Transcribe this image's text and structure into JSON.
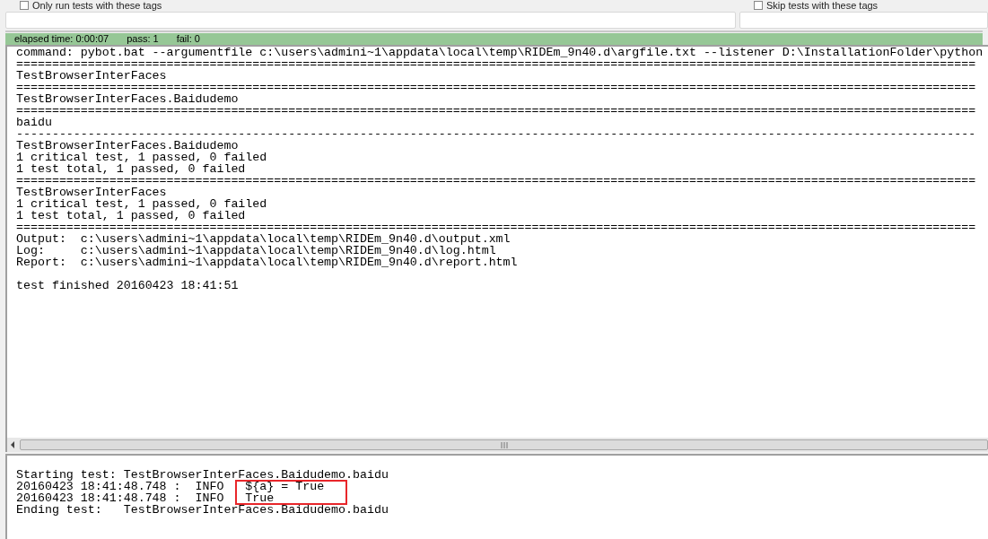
{
  "filters": [
    {
      "label": "Only run tests with these tags",
      "checked": false
    },
    {
      "label": "Skip tests with these tags",
      "checked": false
    }
  ],
  "status": {
    "elapsed": "elapsed time: 0:00:07",
    "pass": "pass: 1",
    "fail": "fail: 0"
  },
  "output_lines": [
    "command: pybot.bat --argumentfile c:\\users\\admini~1\\appdata\\local\\temp\\RIDEm_9n40.d\\argfile.txt --listener D:\\InstallationFolder\\python",
    "======================================================================================================================================",
    "TestBrowserInterFaces",
    "======================================================================================================================================",
    "TestBrowserInterFaces.Baidudemo",
    "======================================================================================================================================",
    "baidu",
    "--------------------------------------------------------------------------------------------------------------------------------------",
    "TestBrowserInterFaces.Baidudemo",
    "1 critical test, 1 passed, 0 failed",
    "1 test total, 1 passed, 0 failed",
    "======================================================================================================================================",
    "TestBrowserInterFaces",
    "1 critical test, 1 passed, 0 failed",
    "1 test total, 1 passed, 0 failed",
    "======================================================================================================================================",
    "Output:  c:\\users\\admini~1\\appdata\\local\\temp\\RIDEm_9n40.d\\output.xml",
    "Log:     c:\\users\\admini~1\\appdata\\local\\temp\\RIDEm_9n40.d\\log.html",
    "Report:  c:\\users\\admini~1\\appdata\\local\\temp\\RIDEm_9n40.d\\report.html"
  ],
  "finish_line": "test finished 20160423 18:41:51",
  "message_lines": [
    "Starting test: TestBrowserInterFaces.Baidudemo.baidu",
    "20160423 18:41:48.748 :  INFO   ${a} = True",
    "20160423 18:41:48.748 :  INFO   True",
    "Ending test:   TestBrowserInterFaces.Baidudemo.baidu"
  ]
}
